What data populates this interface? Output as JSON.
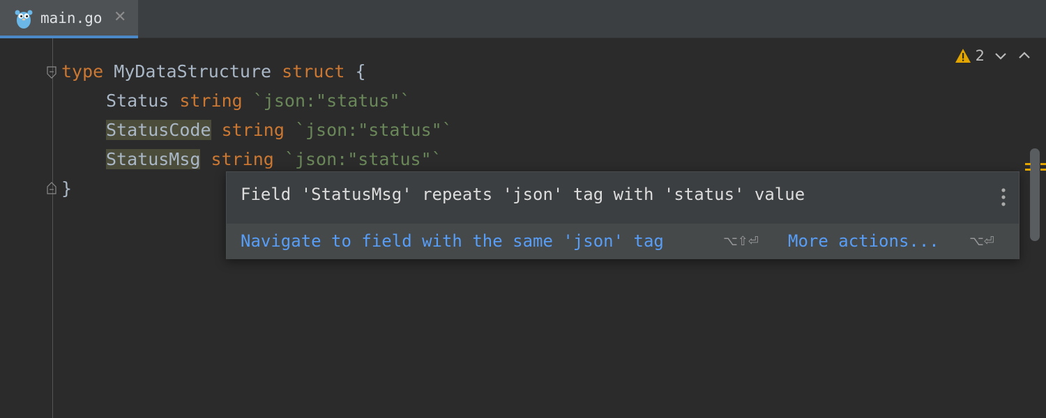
{
  "tab": {
    "label": "main.go",
    "icon": "gopher-icon",
    "close_glyph": "✕"
  },
  "code": {
    "line1": {
      "kw": "type",
      "name": "MyDataStructure",
      "kw2": "struct",
      "brace": "{"
    },
    "line2": {
      "field": "Status",
      "type": "string",
      "tag": "`json:\"status\"`"
    },
    "line3": {
      "field": "StatusCode",
      "type": "string",
      "tag": "`json:\"status\"`"
    },
    "line4": {
      "field": "StatusMsg",
      "type": "string",
      "tag": "`json:\"status\"`"
    },
    "line5": {
      "brace": "}"
    }
  },
  "inspection": {
    "warning_count": "2"
  },
  "popup": {
    "message": "Field 'StatusMsg' repeats 'json' tag with 'status' value",
    "primary_action": "Navigate to field with the same 'json' tag",
    "primary_shortcut": "⌥⇧⏎",
    "more_action": "More actions...",
    "more_shortcut": "⌥⏎"
  },
  "colors": {
    "keyword": "#cc7832",
    "string": "#6a8759",
    "link": "#589df6",
    "warning": "#e2a500",
    "accent": "#4a88c7"
  }
}
